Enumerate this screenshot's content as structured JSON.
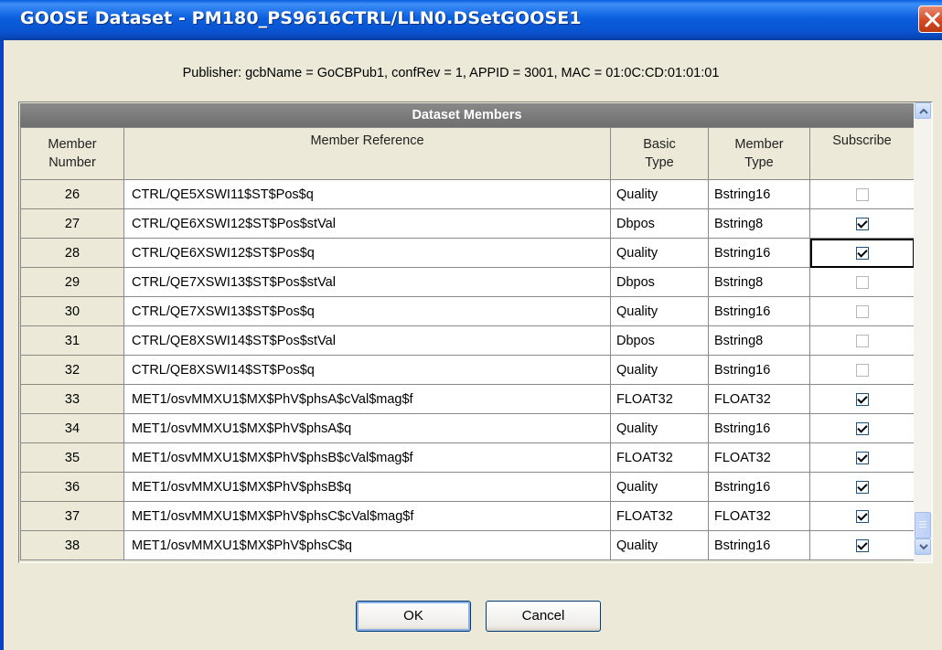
{
  "window": {
    "title": "GOOSE Dataset - PM180_PS9616CTRL/LLN0.DSetGOOSE1"
  },
  "publisher": "Publisher: gcbName = GoCBPub1, confRev = 1, APPID = 3001, MAC = 01:0C:CD:01:01:01",
  "grid": {
    "band_title": "Dataset Members",
    "headers": {
      "member_number": [
        "Member",
        "Number"
      ],
      "member_reference": "Member Reference",
      "basic_type": [
        "Basic",
        "Type"
      ],
      "member_type": [
        "Member",
        "Type"
      ],
      "subscribe": "Subscribe"
    },
    "rows": [
      {
        "number": "26",
        "reference": "CTRL/QE5XSWI11$ST$Pos$q",
        "basic_type": "Quality",
        "member_type": "Bstring16",
        "subscribe": false
      },
      {
        "number": "27",
        "reference": "CTRL/QE6XSWI12$ST$Pos$stVal",
        "basic_type": "Dbpos",
        "member_type": "Bstring8",
        "subscribe": true
      },
      {
        "number": "28",
        "reference": "CTRL/QE6XSWI12$ST$Pos$q",
        "basic_type": "Quality",
        "member_type": "Bstring16",
        "subscribe": true
      },
      {
        "number": "29",
        "reference": "CTRL/QE7XSWI13$ST$Pos$stVal",
        "basic_type": "Dbpos",
        "member_type": "Bstring8",
        "subscribe": false
      },
      {
        "number": "30",
        "reference": "CTRL/QE7XSWI13$ST$Pos$q",
        "basic_type": "Quality",
        "member_type": "Bstring16",
        "subscribe": false
      },
      {
        "number": "31",
        "reference": "CTRL/QE8XSWI14$ST$Pos$stVal",
        "basic_type": "Dbpos",
        "member_type": "Bstring8",
        "subscribe": false
      },
      {
        "number": "32",
        "reference": "CTRL/QE8XSWI14$ST$Pos$q",
        "basic_type": "Quality",
        "member_type": "Bstring16",
        "subscribe": false
      },
      {
        "number": "33",
        "reference": "MET1/osvMMXU1$MX$PhV$phsA$cVal$mag$f",
        "basic_type": "FLOAT32",
        "member_type": "FLOAT32",
        "subscribe": true
      },
      {
        "number": "34",
        "reference": "MET1/osvMMXU1$MX$PhV$phsA$q",
        "basic_type": "Quality",
        "member_type": "Bstring16",
        "subscribe": true
      },
      {
        "number": "35",
        "reference": "MET1/osvMMXU1$MX$PhV$phsB$cVal$mag$f",
        "basic_type": "FLOAT32",
        "member_type": "FLOAT32",
        "subscribe": true
      },
      {
        "number": "36",
        "reference": "MET1/osvMMXU1$MX$PhV$phsB$q",
        "basic_type": "Quality",
        "member_type": "Bstring16",
        "subscribe": true
      },
      {
        "number": "37",
        "reference": "MET1/osvMMXU1$MX$PhV$phsC$cVal$mag$f",
        "basic_type": "FLOAT32",
        "member_type": "FLOAT32",
        "subscribe": true
      },
      {
        "number": "38",
        "reference": "MET1/osvMMXU1$MX$PhV$phsC$q",
        "basic_type": "Quality",
        "member_type": "Bstring16",
        "subscribe": true
      }
    ],
    "focused_row": "28"
  },
  "buttons": {
    "ok": "OK",
    "cancel": "Cancel"
  },
  "icons": {
    "close": "close-icon",
    "scroll_up": "chevron-up-icon",
    "scroll_down": "chevron-down-icon",
    "checkbox": "checkbox-icon"
  },
  "colors": {
    "titlebar": "#0a5ee0",
    "close": "#d2461f",
    "header_band": "#7a7a7a",
    "window_bg": "#ece9d8"
  }
}
